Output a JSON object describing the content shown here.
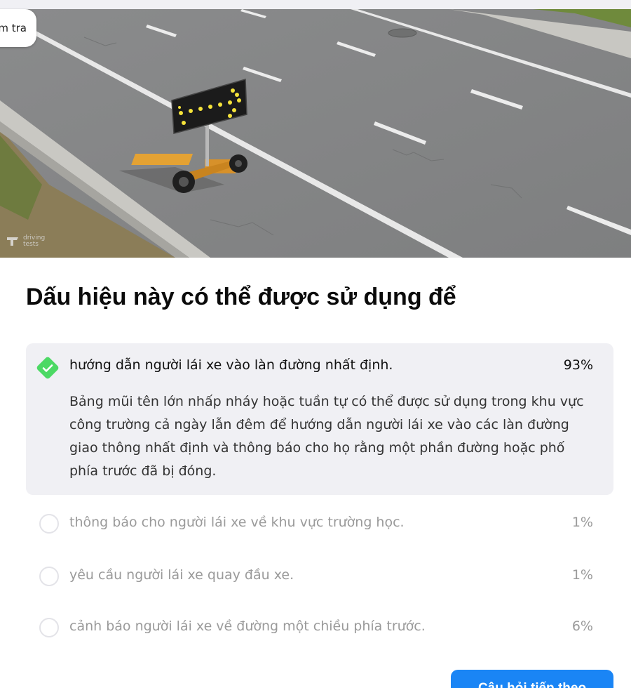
{
  "header": {
    "pill_label": "m tra"
  },
  "scene": {
    "watermark": "driving tests"
  },
  "question": {
    "title": "Dấu hiệu này có thể được sử dụng để"
  },
  "answers": [
    {
      "text": "hướng dẫn người lái xe vào làn đường nhất định.",
      "percent": "93%",
      "correct": true,
      "explanation": "Bảng mũi tên lớn nhấp nháy hoặc tuần tự có thể được sử dụng trong khu vực công trường cả ngày lẫn đêm để hướng dẫn người lái xe vào các làn đường giao thông nhất định và thông báo cho họ rằng một phần đường hoặc phố phía trước đã bị đóng."
    },
    {
      "text": "thông báo cho người lái xe về khu vực trường học.",
      "percent": "1%",
      "correct": false
    },
    {
      "text": "yêu cầu người lái xe quay đầu xe.",
      "percent": "1%",
      "correct": false
    },
    {
      "text": "cảnh báo người lái xe về đường một chiều phía trước.",
      "percent": "6%",
      "correct": false
    }
  ],
  "actions": {
    "next_label": "Câu hỏi tiếp theo"
  },
  "colors": {
    "accent": "#1a85f5",
    "correct_green": "#4cd964",
    "selected_bg": "#f0f0f4"
  }
}
